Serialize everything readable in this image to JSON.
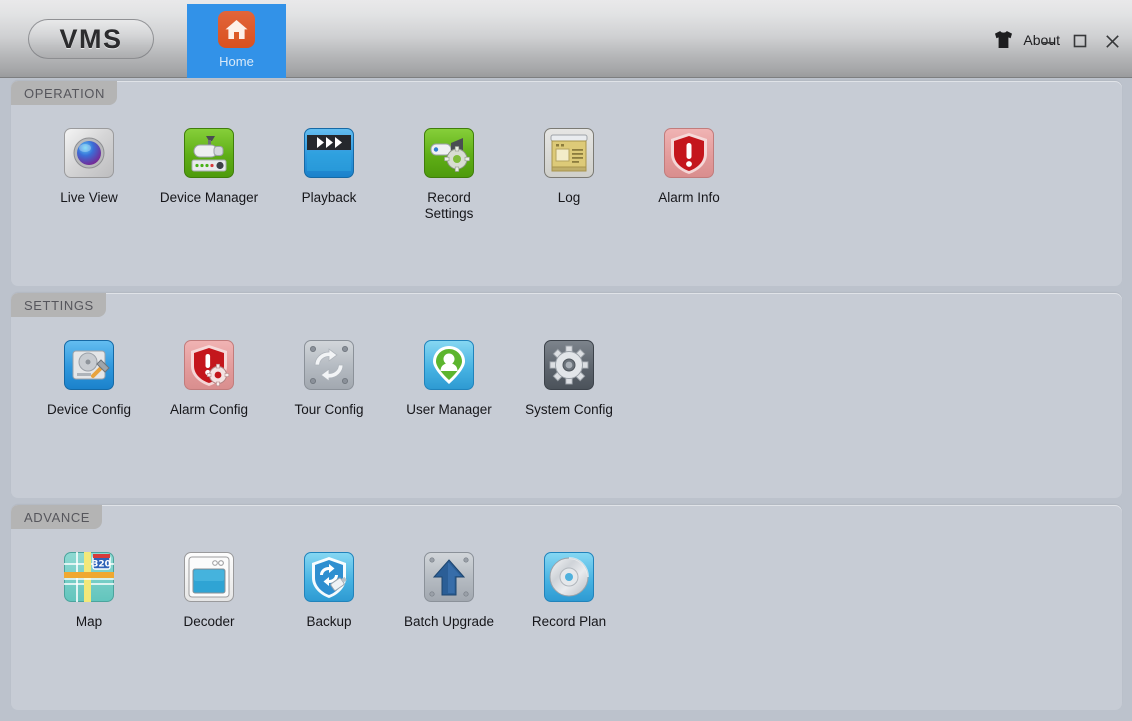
{
  "window": {
    "logo": "VMS",
    "about_label": "About",
    "about_icon": "tshirt-icon",
    "controls": [
      {
        "name": "minimize-button",
        "glyph": "minimize-icon"
      },
      {
        "name": "maximize-button",
        "glyph": "maximize-icon"
      },
      {
        "name": "close-button",
        "glyph": "close-icon"
      }
    ]
  },
  "tabs": [
    {
      "label": "Home",
      "icon": "house-icon",
      "active": true
    }
  ],
  "colors": {
    "accent_tab": "#3292e8",
    "home_icon": "#d9511f",
    "panel_bg": "#c7ccd5",
    "app_bg": "#bcc2cc",
    "section_tab_bg": "#b4b4b4",
    "section_tab_text": "#56565c",
    "caption_text": "#16161a"
  },
  "sections": [
    {
      "title": "OPERATION",
      "items": [
        {
          "label": "Live View",
          "icon": "dome-camera-icon"
        },
        {
          "label": "Device Manager",
          "icon": "bullet-camera-icon"
        },
        {
          "label": "Playback",
          "icon": "film-clapper-icon"
        },
        {
          "label": "Record\nSettings",
          "icon": "camera-gear-icon"
        },
        {
          "label": "Log",
          "icon": "document-icon"
        },
        {
          "label": "Alarm Info",
          "icon": "shield-alert-icon"
        }
      ]
    },
    {
      "title": "SETTINGS",
      "items": [
        {
          "label": "Device Config",
          "icon": "disk-hammer-icon"
        },
        {
          "label": "Alarm Config",
          "icon": "shield-gear-icon"
        },
        {
          "label": "Tour Config",
          "icon": "refresh-plate-icon"
        },
        {
          "label": "User Manager",
          "icon": "user-pin-icon"
        },
        {
          "label": "System Config",
          "icon": "gear-icon"
        }
      ]
    },
    {
      "title": "ADVANCE",
      "items": [
        {
          "label": "Map",
          "icon": "road-map-icon",
          "badge": "320"
        },
        {
          "label": "Decoder",
          "icon": "monitor-window-icon"
        },
        {
          "label": "Backup",
          "icon": "shield-sync-icon"
        },
        {
          "label": "Batch Upgrade",
          "icon": "upload-arrow-icon"
        },
        {
          "label": "Record Plan",
          "icon": "disc-icon"
        }
      ]
    }
  ]
}
